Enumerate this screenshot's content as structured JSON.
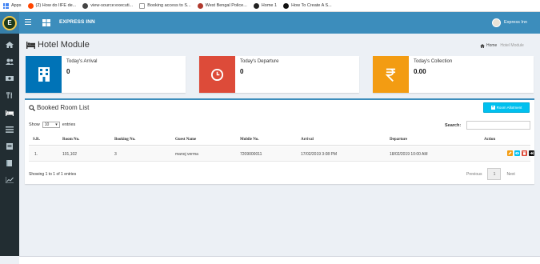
{
  "bookmarks": [
    {
      "label": "Apps",
      "icon": "apps-icon"
    },
    {
      "label": "(2) How do IIFE de...",
      "icon": "reddit-icon",
      "color": "#ff4500"
    },
    {
      "label": "view-source:executi...",
      "icon": "globe-icon",
      "color": "#333333"
    },
    {
      "label": "Booking access to S...",
      "icon": "page-icon",
      "color": "#1a73e8"
    },
    {
      "label": "West Bengal Police...",
      "icon": "emblem-icon",
      "color": "#b03a2e"
    },
    {
      "label": "Home 1",
      "icon": "github-icon",
      "color": "#222222"
    },
    {
      "label": "How To Create A S...",
      "icon": "dot-icon",
      "color": "#111111"
    }
  ],
  "header": {
    "brand": "EXPRESS INN",
    "user": "Express Inn",
    "logo_letter": "E"
  },
  "page": {
    "title": "Hotel Module",
    "breadcrumb_home": "Home",
    "breadcrumb_current": "Hotel Module"
  },
  "cards": [
    {
      "label": "Today's Arrival",
      "value": "0",
      "color": "#0073b7",
      "icon": "building-icon"
    },
    {
      "label": "Today's Departure",
      "value": "0",
      "color": "#dd4b39",
      "icon": "clock-icon"
    },
    {
      "label": "Today's Collection",
      "value": "0.00",
      "color": "#f39c12",
      "icon": "rupee-icon"
    }
  ],
  "list": {
    "title": "Booked Room List",
    "add_button": "Room Allotment",
    "show_label": "Show",
    "show_value": "10",
    "entries_label": "entries",
    "search_label": "Search:",
    "columns": [
      "S.R.",
      "Room No.",
      "Booking No.",
      "Guest Name",
      "Mobile No.",
      "Arrival",
      "Departure",
      "Action"
    ],
    "rows": [
      {
        "sr": "1.",
        "room": "101,102",
        "booking": "3",
        "guest": "manoj verma",
        "mobile": "7209000011",
        "arrival": "17/02/2019 3:08 PM",
        "departure": "18/02/2019 10:00 AM"
      }
    ],
    "action_colors": [
      "#f39c12",
      "#00c0ef",
      "#dd4b39",
      "#111111"
    ],
    "showing": "Showing 1 to 1 of 1 entries",
    "prev": "Previous",
    "page": "1",
    "next": "Next"
  },
  "colors": {
    "header": "#3c8dbc",
    "sidebar": "#222d32",
    "accent": "#3c8dbc"
  }
}
